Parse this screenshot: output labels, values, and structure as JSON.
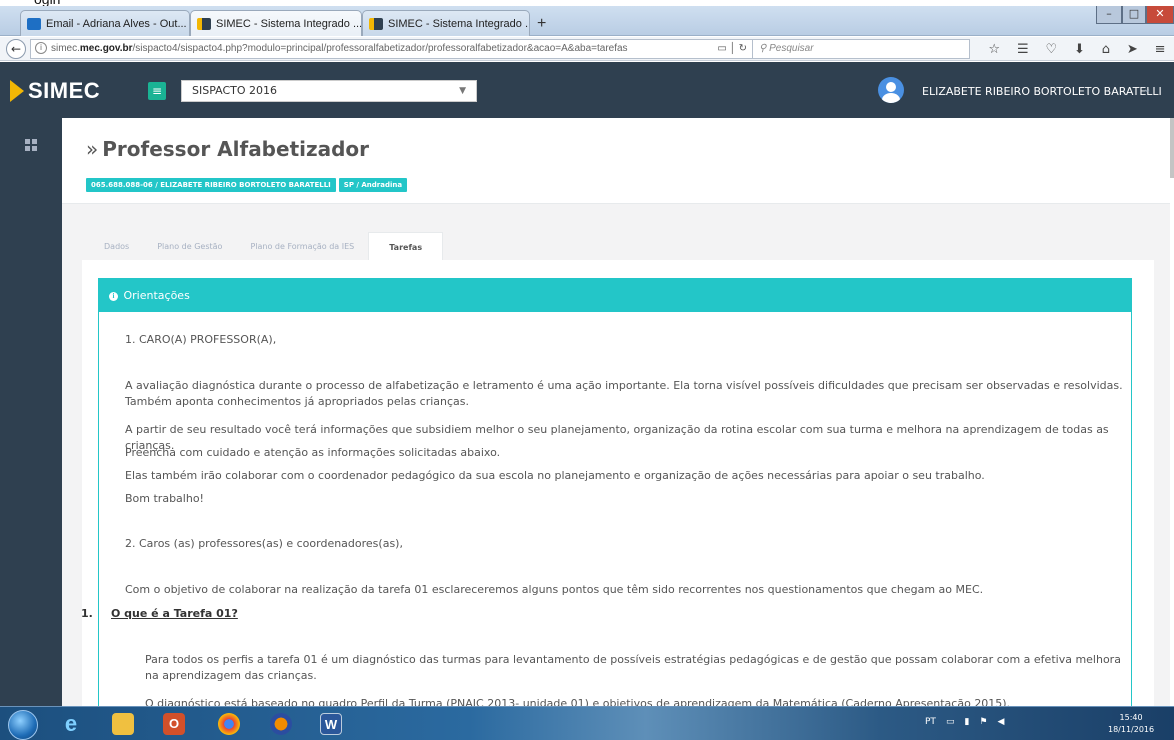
{
  "browser": {
    "crop_text": "ogin",
    "tabs": [
      {
        "label": "Email - Adriana Alves - Out...",
        "icon": "outlook-icon"
      },
      {
        "label": "SIMEC - Sistema Integrado ...",
        "icon": "simec-favicon"
      },
      {
        "label": "SIMEC - Sistema Integrado ...",
        "icon": "simec-favicon"
      }
    ],
    "new_tab": "+",
    "url_host_prefix": "simec.",
    "url_host_bold": "mec.gov.br",
    "url_path": "/sispacto4/sispacto4.php?modulo=principal/professoralfabetizador/professoralfabetizador&acao=A&aba=tarefas",
    "search_placeholder": "Pesquisar"
  },
  "app": {
    "logo_text": "SIMEC",
    "program_select": "SISPACTO 2016",
    "user_name": "ELIZABETE RIBEIRO BORTOLETO BARATELLI"
  },
  "page": {
    "title_prefix": "»",
    "title": "Professor Alfabetizador",
    "badges": [
      "065.688.088-06 / ELIZABETE RIBEIRO BORTOLETO BARATELLI",
      "SP / Andradina"
    ],
    "tabs": [
      "Dados",
      "Plano de Gestão",
      "Plano de Formação da IES",
      "Tarefas"
    ],
    "active_tab": "Tarefas"
  },
  "panel": {
    "heading": "Orientações",
    "paragraphs": [
      "1. CARO(A) PROFESSOR(A),",
      "A avaliação diagnóstica durante o processo de alfabetização e letramento é uma ação importante. Ela torna visível possíveis dificuldades que precisam ser observadas e resolvidas. Também aponta conhecimentos já apropriados pelas crianças.",
      "A partir de seu resultado você terá informações que subsidiem melhor o seu planejamento, organização da rotina escolar com sua turma e melhora na aprendizagem de todas as crianças.",
      "Preencha com cuidado e atenção as informações solicitadas abaixo.",
      "Elas também irão colaborar com o coordenador pedagógico da sua escola no planejamento e organização de ações necessárias para apoiar o seu trabalho.",
      "Bom trabalho!",
      "2. Caros (as) professores(as) e coordenadores(as),",
      "Com o objetivo de colaborar na realização da tarefa 01 esclareceremos alguns pontos que têm sido recorrentes nos questionamentos que chegam ao MEC."
    ],
    "question_number": "1.",
    "question_title": "O que é a Tarefa 01?",
    "answer_paragraphs": [
      "Para todos os perfis a tarefa 01 é um diagnóstico das turmas para levantamento de possíveis estratégias pedagógicas e de gestão que possam colaborar com a efetiva melhora na aprendizagem das crianças.",
      "O diagnóstico está baseado no quadro Perfil da Turma (PNAIC 2013- unidade 01) e objetivos de aprendizagem da Matemática (Caderno Apresentação 2015)."
    ]
  },
  "taskbar": {
    "language": "PT",
    "time": "15:40",
    "date": "18/11/2016"
  }
}
